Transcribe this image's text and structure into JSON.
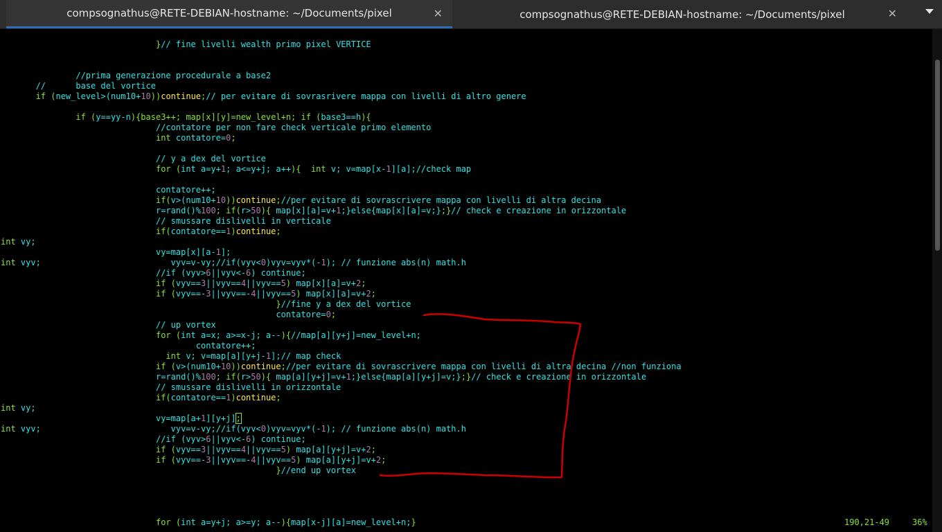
{
  "window": {
    "tabs": [
      {
        "title": "compsognathus@RETE-DEBIAN-hostname: ~/Documents/pixel",
        "active": true,
        "close_glyph": "✕"
      },
      {
        "title": "compsognathus@RETE-DEBIAN-hostname: ~/Documents/pixel",
        "active": false,
        "close_glyph": "✕"
      }
    ],
    "menu_icon": "chevron-down-icon"
  },
  "colors": {
    "background": "#000000",
    "default_text": "#8ae234",
    "comment": "#34e2e2",
    "number": "#ad7fa8",
    "keyword": "#fce94f",
    "active_tab_indicator": "#2f6db5",
    "annotation": "#cc0000"
  },
  "editor": {
    "lines": [
      [
        {
          "t": "                               "
        },
        {
          "t": "}",
          "c": "df"
        },
        {
          "t": "// fine livelli wealth primo pixel VERTICE",
          "c": "cm"
        }
      ],
      [
        {
          "t": ""
        }
      ],
      [
        {
          "t": ""
        }
      ],
      [
        {
          "t": "               "
        },
        {
          "t": "//prima generazione procedurale a base2",
          "c": "cm"
        }
      ],
      [
        {
          "t": "       "
        },
        {
          "t": "//      base del vortice",
          "c": "cm"
        }
      ],
      [
        {
          "t": "       if ("
        },
        {
          "t": "new_level>(num10+",
          "c": "cm"
        },
        {
          "t": "10",
          "c": "nm"
        },
        {
          "t": "))"
        },
        {
          "t": "continue",
          "c": "kw"
        },
        {
          "t": ";"
        },
        {
          "t": "// per evitare di sovrasrivere mappa con livelli di altro genere",
          "c": "cm"
        }
      ],
      [
        {
          "t": ""
        }
      ],
      [
        {
          "t": "               if ("
        },
        {
          "t": "y==yy-n",
          "c": "cm"
        },
        {
          "t": "){base3++; map[x][y]=new_level+n; if ("
        },
        {
          "t": "base3==h",
          "c": "cm"
        },
        {
          "t": "){"
        }
      ],
      [
        {
          "t": "                               "
        },
        {
          "t": "//contatore per non fare check verticale primo elemento",
          "c": "cm"
        }
      ],
      [
        {
          "t": "                               int "
        },
        {
          "t": "contatore=",
          "c": "cm"
        },
        {
          "t": "0",
          "c": "nm"
        },
        {
          "t": ";"
        }
      ],
      [
        {
          "t": ""
        }
      ],
      [
        {
          "t": "                               "
        },
        {
          "t": "// y a dex del vortice",
          "c": "cm"
        }
      ],
      [
        {
          "t": "                               for ("
        },
        {
          "t": "int a=y+",
          "c": "cm"
        },
        {
          "t": "1",
          "c": "nm"
        },
        {
          "t": "; a<=y+j; a++",
          "c": "cm"
        },
        {
          "t": "){  int "
        },
        {
          "t": "v; v=map[x-",
          "c": "cm"
        },
        {
          "t": "1",
          "c": "nm"
        },
        {
          "t": "][a];",
          "c": "cm"
        },
        {
          "t": "//check map",
          "c": "cm"
        }
      ],
      [
        {
          "t": ""
        }
      ],
      [
        {
          "t": "                               "
        },
        {
          "t": "contatore++;",
          "c": "cm"
        }
      ],
      [
        {
          "t": "                               if("
        },
        {
          "t": "v>(num10+",
          "c": "cm"
        },
        {
          "t": "10",
          "c": "nm"
        },
        {
          "t": "))"
        },
        {
          "t": "continue",
          "c": "kw"
        },
        {
          "t": ";"
        },
        {
          "t": "//per evitare di sovrascrivere mappa con livelli di altra decina",
          "c": "cm"
        }
      ],
      [
        {
          "t": "                               "
        },
        {
          "t": "r=rand()%",
          "c": "cm"
        },
        {
          "t": "100",
          "c": "nm"
        },
        {
          "t": "; if("
        },
        {
          "t": "r>",
          "c": "cm"
        },
        {
          "t": "50",
          "c": "nm"
        },
        {
          "t": "){ "
        },
        {
          "t": "map[x][a]=v+",
          "c": "cm"
        },
        {
          "t": "1",
          "c": "nm"
        },
        {
          "t": ";}else{",
          "c": "cm"
        },
        {
          "t": "map[x][a]=v;}",
          "c": "cm"
        },
        {
          "t": ";}"
        },
        {
          "t": "// check e creazione in orizzontale",
          "c": "cm"
        }
      ],
      [
        {
          "t": "                               "
        },
        {
          "t": "// smussare dislivelli in verticale",
          "c": "cm"
        }
      ],
      [
        {
          "t": "                               if("
        },
        {
          "t": "contatore==",
          "c": "cm"
        },
        {
          "t": "1",
          "c": "nm"
        },
        {
          "t": ")"
        },
        {
          "t": "continue",
          "c": "kw"
        },
        {
          "t": ";"
        }
      ],
      [
        {
          "t": "int "
        },
        {
          "t": "vy;",
          "c": "cm"
        }
      ],
      [
        {
          "t": "                               "
        },
        {
          "t": "vy=map[x][a-",
          "c": "cm"
        },
        {
          "t": "1",
          "c": "nm"
        },
        {
          "t": "];",
          "c": "cm"
        }
      ],
      [
        {
          "t": "int "
        },
        {
          "t": "vyv;",
          "c": "cm"
        },
        {
          "t": "                          "
        },
        {
          "t": "vyv=v-vy;",
          "c": "cm"
        },
        {
          "t": "//if(vyv<",
          "c": "cm"
        },
        {
          "t": "0",
          "c": "nm"
        },
        {
          "t": ")vyv=vyv*(-",
          "c": "cm"
        },
        {
          "t": "1",
          "c": "nm"
        },
        {
          "t": "); // funzione abs(n) math.h",
          "c": "cm"
        }
      ],
      [
        {
          "t": "                               "
        },
        {
          "t": "//if (vyv>",
          "c": "cm"
        },
        {
          "t": "6",
          "c": "nm"
        },
        {
          "t": "||vyv<-",
          "c": "cm"
        },
        {
          "t": "6",
          "c": "nm"
        },
        {
          "t": ") continue;",
          "c": "cm"
        }
      ],
      [
        {
          "t": "                               if ("
        },
        {
          "t": "vyv==",
          "c": "cm"
        },
        {
          "t": "3",
          "c": "nm"
        },
        {
          "t": "||vyv==",
          "c": "cm"
        },
        {
          "t": "4",
          "c": "nm"
        },
        {
          "t": "||vyv==",
          "c": "cm"
        },
        {
          "t": "5",
          "c": "nm"
        },
        {
          "t": ") "
        },
        {
          "t": "map[x][a]=v+",
          "c": "cm"
        },
        {
          "t": "2",
          "c": "nm"
        },
        {
          "t": ";"
        }
      ],
      [
        {
          "t": "                               if ("
        },
        {
          "t": "vyv==-",
          "c": "cm"
        },
        {
          "t": "3",
          "c": "nm"
        },
        {
          "t": "||vyv==-",
          "c": "cm"
        },
        {
          "t": "4",
          "c": "nm"
        },
        {
          "t": "||vyv==",
          "c": "cm"
        },
        {
          "t": "5",
          "c": "nm"
        },
        {
          "t": ") "
        },
        {
          "t": "map[x][a]=v+",
          "c": "cm"
        },
        {
          "t": "2",
          "c": "nm"
        },
        {
          "t": ";"
        }
      ],
      [
        {
          "t": "                                                       }"
        },
        {
          "t": "//fine y a dex del vortice",
          "c": "cm"
        }
      ],
      [
        {
          "t": "                                                       "
        },
        {
          "t": "contatore=",
          "c": "cm"
        },
        {
          "t": "0",
          "c": "nm"
        },
        {
          "t": ";"
        }
      ],
      [
        {
          "t": "                               "
        },
        {
          "t": "// up vortex",
          "c": "cm"
        }
      ],
      [
        {
          "t": "                               for ("
        },
        {
          "t": "int a=x; a>=x-j; a--",
          "c": "cm"
        },
        {
          "t": "){"
        },
        {
          "t": "//map[a][y+j]=new_level+n;",
          "c": "cm"
        }
      ],
      [
        {
          "t": "                                       "
        },
        {
          "t": "contatore++;",
          "c": "cm"
        }
      ],
      [
        {
          "t": "                                 int "
        },
        {
          "t": "v; v=map[a][y+j-",
          "c": "cm"
        },
        {
          "t": "1",
          "c": "nm"
        },
        {
          "t": "];",
          "c": "cm"
        },
        {
          "t": "// map check",
          "c": "cm"
        }
      ],
      [
        {
          "t": "                               if ("
        },
        {
          "t": "v>(num10+",
          "c": "cm"
        },
        {
          "t": "10",
          "c": "nm"
        },
        {
          "t": "))"
        },
        {
          "t": "continue",
          "c": "kw"
        },
        {
          "t": ";"
        },
        {
          "t": "//per evitare di sovrascrivere mappa con livelli di altra decina //non funziona",
          "c": "cm"
        }
      ],
      [
        {
          "t": "                               "
        },
        {
          "t": "r=rand()%",
          "c": "cm"
        },
        {
          "t": "100",
          "c": "nm"
        },
        {
          "t": "; if("
        },
        {
          "t": "r>",
          "c": "cm"
        },
        {
          "t": "50",
          "c": "nm"
        },
        {
          "t": "){ "
        },
        {
          "t": "map[a][y+j]=v+",
          "c": "cm"
        },
        {
          "t": "1",
          "c": "nm"
        },
        {
          "t": ";}else{",
          "c": "cm"
        },
        {
          "t": "map[a][y+j]=v;}",
          "c": "cm"
        },
        {
          "t": ";}"
        },
        {
          "t": "// check e creazione in orizzontale",
          "c": "cm"
        }
      ],
      [
        {
          "t": "                               "
        },
        {
          "t": "// smussare dislivelli in orizzontale",
          "c": "cm"
        }
      ],
      [
        {
          "t": "                               if("
        },
        {
          "t": "contatore==",
          "c": "cm"
        },
        {
          "t": "1",
          "c": "nm"
        },
        {
          "t": ")"
        },
        {
          "t": "continue",
          "c": "kw"
        },
        {
          "t": ";"
        }
      ],
      [
        {
          "t": "int "
        },
        {
          "t": "vy;",
          "c": "cm"
        }
      ],
      [
        {
          "t": "                               "
        },
        {
          "t": "vy=map[a+",
          "c": "cm"
        },
        {
          "t": "1",
          "c": "nm"
        },
        {
          "t": "][y+j]",
          "c": "cm"
        },
        {
          "t": ";",
          "cursor": true
        }
      ],
      [
        {
          "t": "int "
        },
        {
          "t": "vyv;",
          "c": "cm"
        },
        {
          "t": "                          "
        },
        {
          "t": "vyv=v-vy;",
          "c": "cm"
        },
        {
          "t": "//if(vyv<",
          "c": "cm"
        },
        {
          "t": "0",
          "c": "nm"
        },
        {
          "t": ")vyv=vyv*(-",
          "c": "cm"
        },
        {
          "t": "1",
          "c": "nm"
        },
        {
          "t": "); // funzione abs(n) math.h",
          "c": "cm"
        }
      ],
      [
        {
          "t": "                               "
        },
        {
          "t": "//if (vyv>",
          "c": "cm"
        },
        {
          "t": "6",
          "c": "nm"
        },
        {
          "t": "||vyv<-",
          "c": "cm"
        },
        {
          "t": "6",
          "c": "nm"
        },
        {
          "t": ") continue;",
          "c": "cm"
        }
      ],
      [
        {
          "t": "                               if ("
        },
        {
          "t": "vyv==",
          "c": "cm"
        },
        {
          "t": "3",
          "c": "nm"
        },
        {
          "t": "||vyv==",
          "c": "cm"
        },
        {
          "t": "4",
          "c": "nm"
        },
        {
          "t": "||vyv==",
          "c": "cm"
        },
        {
          "t": "5",
          "c": "nm"
        },
        {
          "t": ") "
        },
        {
          "t": "map[a][y+j]=v+",
          "c": "cm"
        },
        {
          "t": "2",
          "c": "nm"
        },
        {
          "t": ";"
        }
      ],
      [
        {
          "t": "                               if ("
        },
        {
          "t": "vyv==-",
          "c": "cm"
        },
        {
          "t": "3",
          "c": "nm"
        },
        {
          "t": "||vyv==-",
          "c": "cm"
        },
        {
          "t": "4",
          "c": "nm"
        },
        {
          "t": "||vyv==",
          "c": "cm"
        },
        {
          "t": "5",
          "c": "nm"
        },
        {
          "t": ") "
        },
        {
          "t": "map[a][y+j]=v+",
          "c": "cm"
        },
        {
          "t": "2",
          "c": "nm"
        },
        {
          "t": ";"
        }
      ],
      [
        {
          "t": "                                                       }"
        },
        {
          "t": "//end up vortex",
          "c": "cm"
        }
      ],
      [
        {
          "t": ""
        }
      ],
      [
        {
          "t": ""
        }
      ],
      [
        {
          "t": ""
        }
      ],
      [
        {
          "t": ""
        }
      ],
      [
        {
          "t": "                               for ("
        },
        {
          "t": "int a=y+j; a>=y; a--",
          "c": "cm"
        },
        {
          "t": "){"
        },
        {
          "t": "map[x-j][a]=new_level+n;",
          "c": "cm"
        },
        {
          "t": "}"
        }
      ]
    ],
    "status": {
      "position": "190,21-49",
      "percent": "36%"
    }
  }
}
